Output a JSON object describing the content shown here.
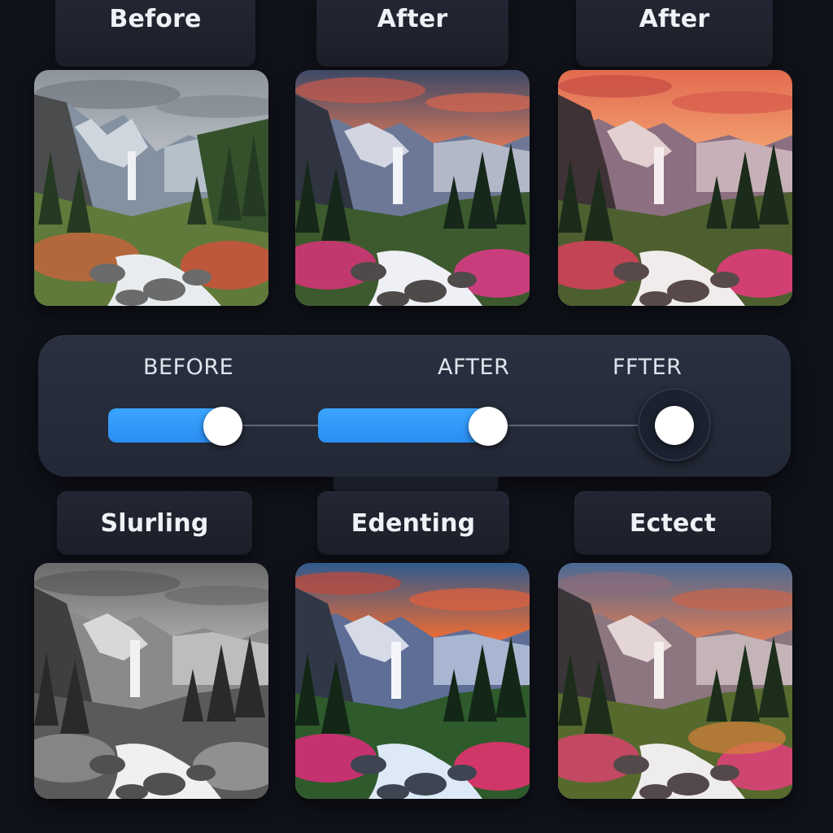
{
  "top_labels": [
    "Before",
    "After",
    "After"
  ],
  "bottom_labels": [
    "Slurling",
    "Edenting",
    "Ectect"
  ],
  "slider_panel": {
    "captions": [
      "BEFORE",
      "AFTER",
      "FFTER"
    ]
  },
  "colors": {
    "background": "#10121a",
    "card": "#232733",
    "panel": "#2a3040",
    "accent": "#2a8ef2",
    "knob": "#ffffff"
  },
  "photos": [
    {
      "name": "before-landscape",
      "style": "muted"
    },
    {
      "name": "after-landscape-1",
      "style": "sunset"
    },
    {
      "name": "after-landscape-2",
      "style": "sunset-warm"
    },
    {
      "name": "slurling-landscape",
      "style": "grayscale"
    },
    {
      "name": "edenting-landscape",
      "style": "vivid"
    },
    {
      "name": "ectect-landscape",
      "style": "vivid-warm"
    }
  ]
}
